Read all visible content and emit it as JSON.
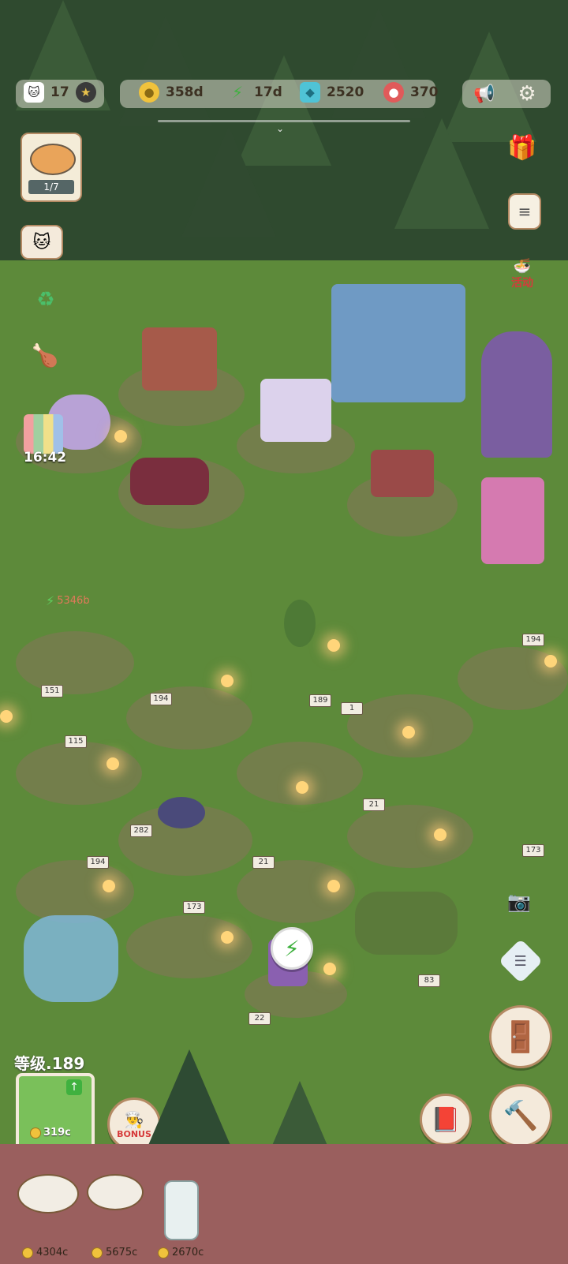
{
  "topbar": {
    "cats": {
      "icon": "cat-face-icon",
      "value": "17"
    },
    "coins": {
      "icon": "coin-icon",
      "value": "358d"
    },
    "energy": {
      "icon": "lightning-icon",
      "value": "17d"
    },
    "gems": {
      "icon": "gem-icon",
      "value": "2520"
    },
    "hearts": {
      "icon": "meat-icon",
      "value": "370"
    }
  },
  "left_panel": {
    "order_progress": "1/7",
    "timer": "16:42"
  },
  "right_panel": {
    "event_label": "活动"
  },
  "floating": {
    "energy_income": "5346b"
  },
  "stations": {
    "signs": [
      "151",
      "115",
      "194",
      "282",
      "194",
      "173",
      "21",
      "1",
      "21",
      "173",
      "189",
      "194",
      "22",
      "83"
    ]
  },
  "player": {
    "level_label": "等级.189",
    "upgrade_cost": "319c"
  },
  "bonus_label": "BONUS",
  "shelf": [
    {
      "name": "sushi-plate",
      "price": "4304c"
    },
    {
      "name": "soup-bowl",
      "price": "5675c"
    },
    {
      "name": "milk-jar",
      "price": "2670c"
    }
  ],
  "colors": {
    "grass": "#5d8a3a",
    "forest": "#2f4a2f",
    "floor": "#9a5f5e",
    "ui_cream": "#f4eadb",
    "ui_border": "#b48a64"
  }
}
